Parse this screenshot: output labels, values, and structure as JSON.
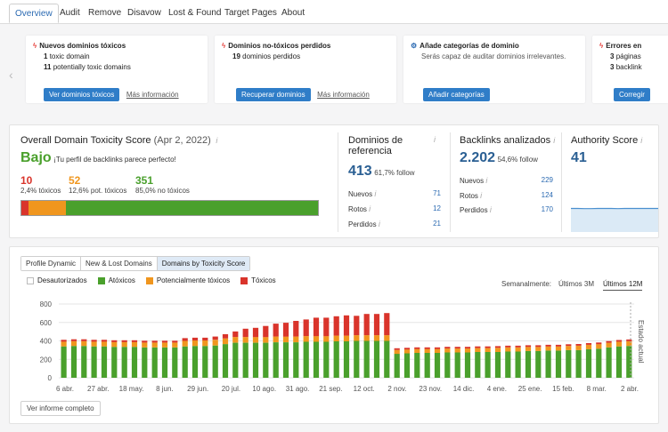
{
  "tabs": [
    {
      "label": "Overview",
      "active": true
    },
    {
      "label": "Audit"
    },
    {
      "label": "Remove"
    },
    {
      "label": "Disavow"
    },
    {
      "label": "Lost & Found"
    },
    {
      "label": "Target Pages"
    },
    {
      "label": "About"
    }
  ],
  "alerts": {
    "toxic": {
      "title": "Nuevos dominios tóxicos",
      "line1_num": "1",
      "line1_text": "toxic domain",
      "line2_num": "11",
      "line2_text": "potentially toxic domains",
      "button": "Ver dominios tóxicos",
      "link": "Más información"
    },
    "lost": {
      "title": "Dominios no-tóxicos perdidos",
      "line1_num": "19",
      "line1_text": "dominios perdidos",
      "button": "Recuperar dominios",
      "link": "Más información"
    },
    "categories": {
      "title": "Añade categorías de dominio",
      "line1_text": "Serás capaz de auditar dominios irrelevantes.",
      "button": "Añadir categorías"
    },
    "errors": {
      "title": "Errores en",
      "line1_num": "3",
      "line1_text": "páginas",
      "line2_num": "3",
      "line2_text": "backlink",
      "button": "Corregir"
    }
  },
  "toxicity": {
    "title": "Overall Domain Toxicity Score",
    "date": "(Apr 2, 2022)",
    "level": "Bajo",
    "level_text": "¡Tu perfil de backlinks parece perfecto!",
    "toxic": {
      "value": "10",
      "label": "2,4% tóxicos",
      "fraction": 0.024
    },
    "potential": {
      "value": "52",
      "label": "12,6% pot. tóxicos",
      "fraction": 0.126
    },
    "non_toxic": {
      "value": "351",
      "label": "85,0% no tóxicos",
      "fraction": 0.85
    }
  },
  "referring": {
    "title1": "Dominios de",
    "title2": "referencia",
    "value": "413",
    "sub": "61,7% follow",
    "rows": [
      {
        "label": "Nuevos",
        "value": "71"
      },
      {
        "label": "Rotos",
        "value": "12"
      },
      {
        "label": "Perdidos",
        "value": "21"
      }
    ]
  },
  "backlinks": {
    "title": "Backlinks analizados",
    "value": "2.202",
    "sub": "54,6% follow",
    "rows": [
      {
        "label": "Nuevos",
        "value": "229"
      },
      {
        "label": "Rotos",
        "value": "124"
      },
      {
        "label": "Perdidos",
        "value": "170"
      }
    ]
  },
  "authority": {
    "title": "Authority Score",
    "value": "41",
    "sparkline": [
      41,
      41,
      40,
      40,
      41,
      41,
      41,
      40,
      41,
      41,
      41,
      41,
      41,
      41
    ]
  },
  "chart_tabs": [
    "Profile Dynamic",
    "New & Lost Domains",
    "Domains by Toxicity Score"
  ],
  "chart_tab_selected": 2,
  "legend": [
    {
      "label": "Desautorizados",
      "color": "#ffffff"
    },
    {
      "label": "Atóxicos",
      "color": "#4aa02c"
    },
    {
      "label": "Potencialmente tóxicos",
      "color": "#f0961e"
    },
    {
      "label": "Tóxicos",
      "color": "#d9342b"
    }
  ],
  "period": {
    "label": "Semanalmente:",
    "options": [
      "Últimos 3M",
      "Últimos 12M"
    ],
    "selected": 1
  },
  "report_button": "Ver informe completo",
  "colors": {
    "accent": "#2f7dc8",
    "non_toxic": "#4aa02c",
    "potential": "#f0961e",
    "toxic": "#d9342b"
  },
  "chart_data": {
    "type": "bar",
    "stacked": true,
    "ylim": [
      0,
      800
    ],
    "yticks": [
      0,
      200,
      400,
      600,
      800
    ],
    "xtick_labels": [
      "6 abr.",
      "27 abr.",
      "18 may.",
      "8 jun.",
      "29 jun.",
      "20 jul.",
      "10 ago.",
      "31 ago.",
      "21 sep.",
      "12 oct.",
      "2 nov.",
      "23 nov.",
      "14 dic.",
      "4 ene.",
      "25 ene.",
      "15 feb.",
      "8 mar.",
      "2 abr."
    ],
    "annotation": "Estado actual",
    "series": [
      {
        "name": "Atóxicos",
        "values": [
          340,
          345,
          345,
          340,
          340,
          335,
          335,
          335,
          330,
          330,
          330,
          330,
          340,
          345,
          345,
          350,
          365,
          380,
          380,
          380,
          380,
          385,
          385,
          385,
          390,
          390,
          390,
          395,
          395,
          400,
          400,
          400,
          400,
          260,
          265,
          270,
          270,
          270,
          275,
          275,
          275,
          280,
          280,
          280,
          285,
          285,
          290,
          290,
          295,
          295,
          300,
          300,
          310,
          315,
          330,
          340,
          345
        ]
      },
      {
        "name": "Potencialmente tóxicos",
        "values": [
          52,
          52,
          52,
          52,
          52,
          52,
          52,
          52,
          52,
          52,
          52,
          52,
          60,
          60,
          60,
          62,
          62,
          62,
          62,
          62,
          62,
          62,
          62,
          62,
          62,
          62,
          62,
          62,
          62,
          62,
          62,
          62,
          62,
          42,
          42,
          42,
          42,
          42,
          42,
          42,
          42,
          42,
          42,
          45,
          45,
          45,
          45,
          45,
          45,
          45,
          45,
          48,
          48,
          50,
          50,
          52,
          52
        ]
      },
      {
        "name": "Tóxicos",
        "values": [
          20,
          20,
          20,
          20,
          20,
          20,
          20,
          20,
          20,
          20,
          20,
          20,
          30,
          30,
          30,
          35,
          45,
          60,
          90,
          100,
          120,
          140,
          150,
          170,
          180,
          200,
          200,
          210,
          220,
          210,
          230,
          230,
          240,
          18,
          18,
          18,
          18,
          18,
          18,
          18,
          18,
          18,
          18,
          18,
          18,
          18,
          18,
          18,
          18,
          18,
          18,
          18,
          18,
          18,
          18,
          18,
          18
        ]
      }
    ]
  }
}
